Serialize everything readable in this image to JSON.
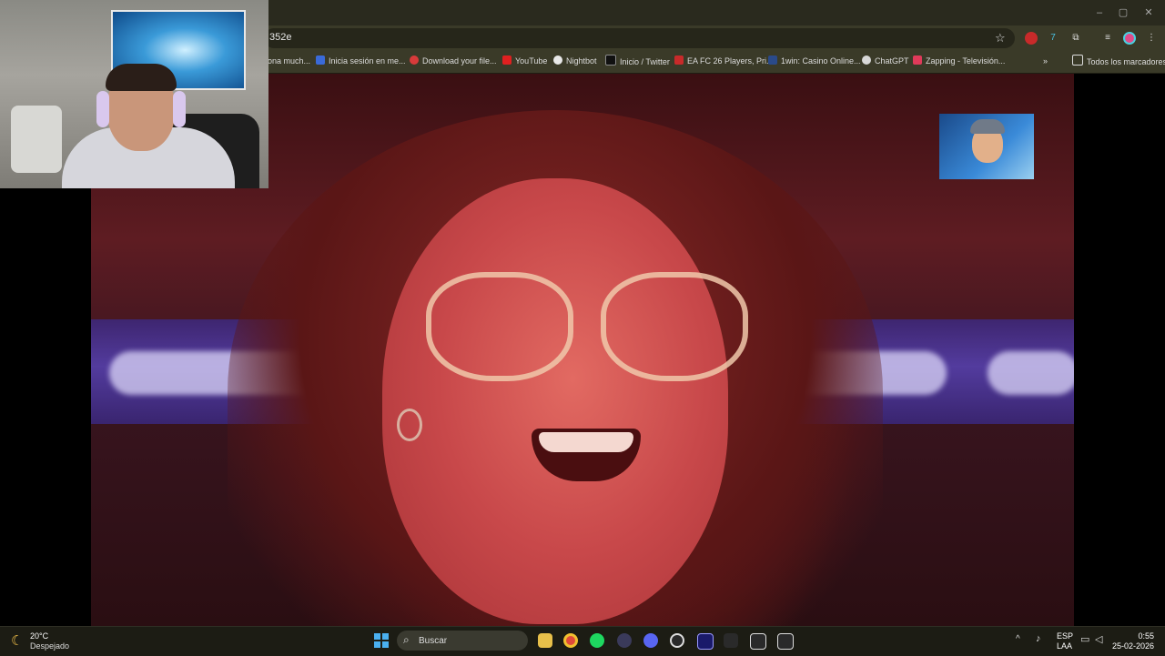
{
  "browser": {
    "url_fragment": "352e",
    "window_controls": [
      "–",
      "▢",
      "✕"
    ],
    "bookmarks": [
      {
        "label": "ona much...",
        "color": "#3a3a28"
      },
      {
        "label": "Inicia sesión en me...",
        "color": "#3a6ad8"
      },
      {
        "label": "Download your file...",
        "color": "#d83a3a"
      },
      {
        "label": "YouTube",
        "color": "#e02020"
      },
      {
        "label": "Nightbot",
        "color": "#e8e8e8"
      },
      {
        "label": "Inicio / Twitter",
        "color": "#111111"
      },
      {
        "label": "EA FC 26 Players, Pri...",
        "color": "#c82a2a"
      },
      {
        "label": "1win: Casino Online...",
        "color": "#2a4a8a"
      },
      {
        "label": "ChatGPT",
        "color": "#d8d8d8"
      },
      {
        "label": "Zapping - Televisión...",
        "color": "#e03a5a"
      }
    ],
    "all_bookmarks_label": "Todos los marcadores"
  },
  "taskbar": {
    "weather": {
      "temp": "20°C",
      "condition": "Despejado"
    },
    "search_placeholder": "Buscar",
    "apps": [
      {
        "name": "file-explorer",
        "color": "#e8c04a"
      },
      {
        "name": "chrome",
        "color": "#e04a3a"
      },
      {
        "name": "spotify",
        "color": "#1ed760"
      },
      {
        "name": "app-dark",
        "color": "#3a3a5a"
      },
      {
        "name": "discord",
        "color": "#5865f2"
      },
      {
        "name": "obs",
        "color": "#2a2a2a"
      },
      {
        "name": "premiere",
        "color": "#1a1a6a"
      },
      {
        "name": "aurora",
        "color": "#2a2a2a"
      },
      {
        "name": "m-app-1",
        "color": "#2a2a2a"
      },
      {
        "name": "m-app-2",
        "color": "#2a2a2a"
      }
    ],
    "tray": {
      "lang1": "ESP",
      "lang2": "LAA",
      "time": "0:55",
      "date": "25-02-2026"
    }
  }
}
